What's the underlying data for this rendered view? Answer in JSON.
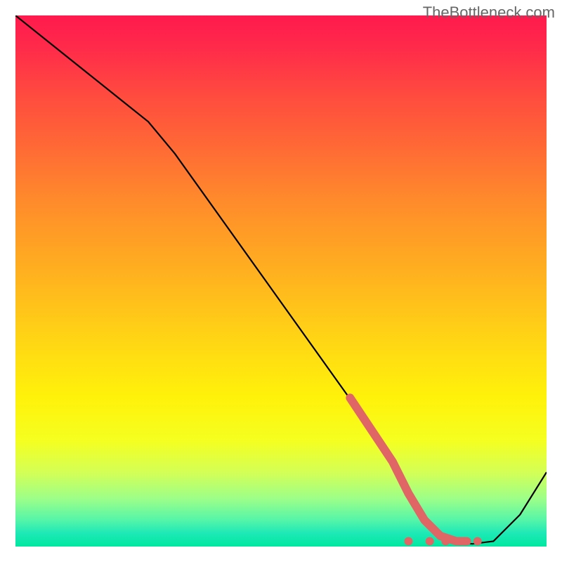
{
  "watermark": "TheBottleneck.com",
  "chart_data": {
    "type": "line",
    "title": "",
    "xlabel": "",
    "ylabel": "",
    "xlim": [
      0,
      100
    ],
    "ylim": [
      0,
      100
    ],
    "series": [
      {
        "name": "bottleneck-curve",
        "color": "#000000",
        "x": [
          0,
          10,
          20,
          25,
          30,
          40,
          50,
          60,
          70,
          74,
          78,
          82,
          86,
          90,
          95,
          100
        ],
        "y": [
          100,
          92,
          84,
          80,
          74,
          60,
          46,
          32,
          18,
          10,
          4,
          1,
          0.5,
          1,
          6,
          14
        ]
      }
    ],
    "highlight_segment": {
      "name": "recommended-zone",
      "color": "#e06666",
      "x": [
        63,
        67,
        71,
        74,
        77,
        80,
        83,
        85
      ],
      "y": [
        28,
        22,
        16,
        10,
        5,
        2,
        1,
        1
      ]
    },
    "highlight_dots": {
      "name": "recommended-points",
      "color": "#e06666",
      "points": [
        {
          "x": 74,
          "y": 1
        },
        {
          "x": 78,
          "y": 1
        },
        {
          "x": 81,
          "y": 1
        },
        {
          "x": 84,
          "y": 1
        },
        {
          "x": 87,
          "y": 1
        }
      ]
    },
    "gradient_stops": [
      {
        "offset": 0.0,
        "color": "#ff1a4d"
      },
      {
        "offset": 0.06,
        "color": "#ff2a4a"
      },
      {
        "offset": 0.15,
        "color": "#ff4b3f"
      },
      {
        "offset": 0.25,
        "color": "#ff6a35"
      },
      {
        "offset": 0.35,
        "color": "#ff8b2b"
      },
      {
        "offset": 0.5,
        "color": "#ffb51e"
      },
      {
        "offset": 0.62,
        "color": "#ffd814"
      },
      {
        "offset": 0.72,
        "color": "#fff20a"
      },
      {
        "offset": 0.8,
        "color": "#f5ff20"
      },
      {
        "offset": 0.86,
        "color": "#d4ff55"
      },
      {
        "offset": 0.91,
        "color": "#9cff88"
      },
      {
        "offset": 0.95,
        "color": "#55f5a8"
      },
      {
        "offset": 0.975,
        "color": "#1de9b6"
      },
      {
        "offset": 1.0,
        "color": "#00e8a0"
      }
    ]
  }
}
